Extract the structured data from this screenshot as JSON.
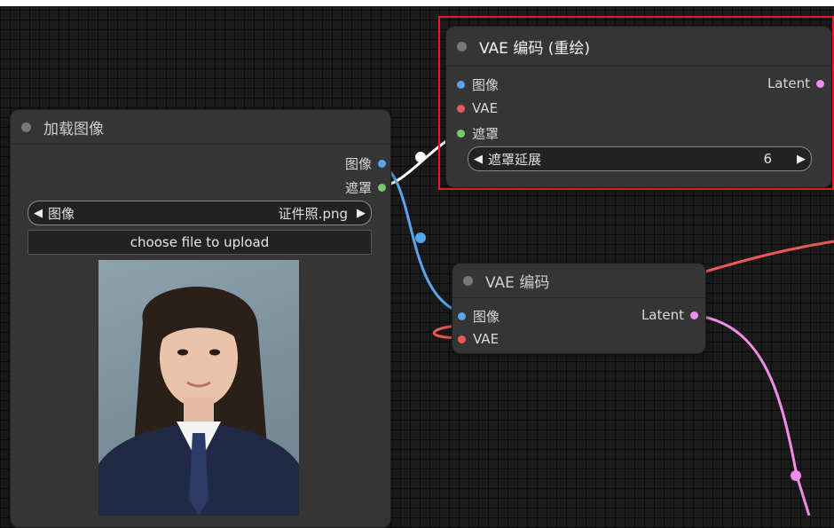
{
  "nodes": {
    "load_image": {
      "title": "加载图像",
      "outputs": [
        "图像",
        "遮罩"
      ],
      "image_widget": {
        "label": "图像",
        "value": "证件照.png"
      },
      "upload_button": "choose file to upload"
    },
    "vae_encode_inpaint": {
      "title": "VAE 编码 (重绘)",
      "inputs": [
        "图像",
        "VAE",
        "遮罩"
      ],
      "output": "Latent",
      "grow_widget": {
        "label": "遮罩延展",
        "value": "6"
      }
    },
    "vae_encode": {
      "title": "VAE 编码",
      "inputs": [
        "图像",
        "VAE"
      ],
      "output": "Latent"
    }
  },
  "colors": {
    "image_slot": "#5aa4ea",
    "vae_slot": "#e85a5a",
    "mask_slot": "#7dc772",
    "latent_slot": "#f08ce6",
    "highlight": "#e01c24"
  },
  "icons": [
    "arrow-left-icon",
    "arrow-right-icon",
    "node-status-dot"
  ]
}
